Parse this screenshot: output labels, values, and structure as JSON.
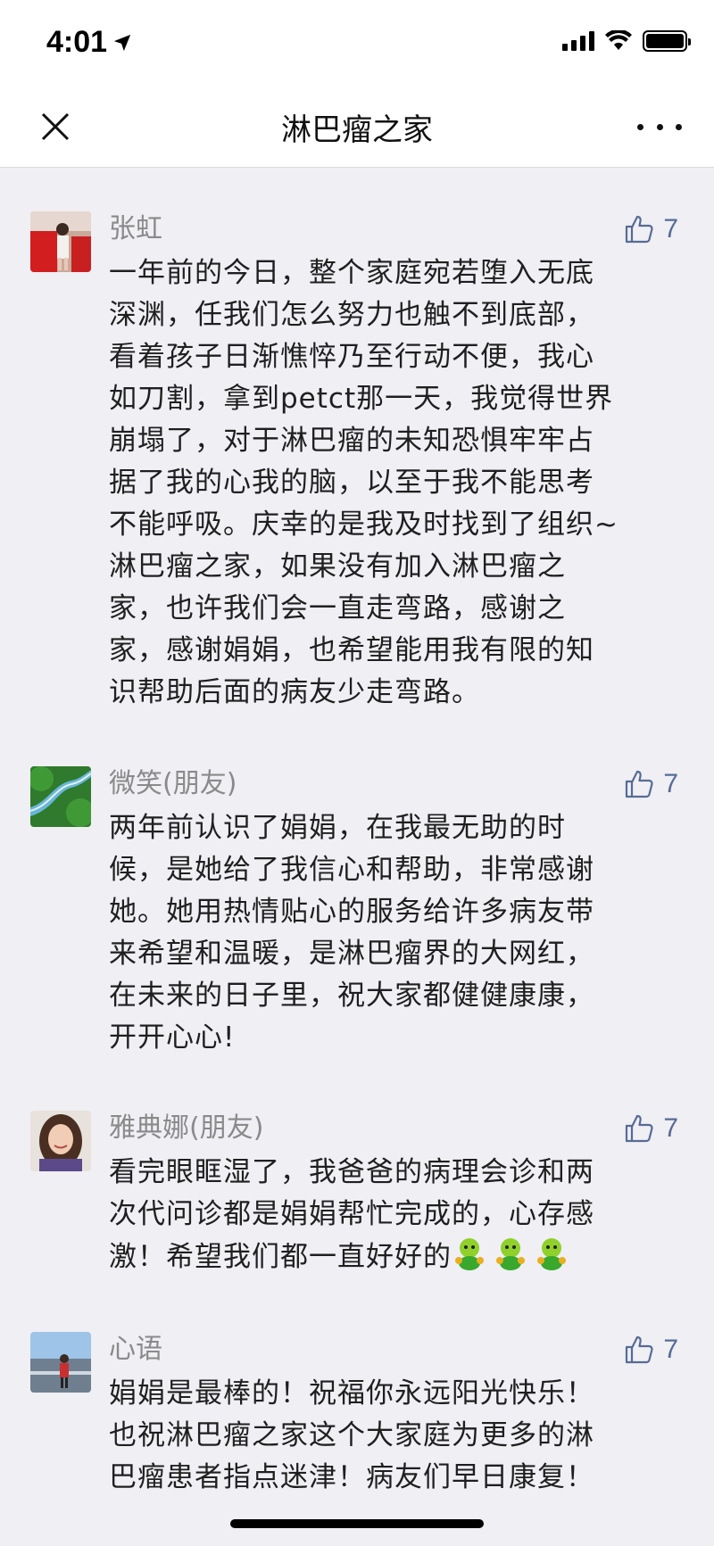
{
  "status_bar": {
    "time": "4:01"
  },
  "header": {
    "title": "淋巴瘤之家"
  },
  "colors": {
    "accent": "#576b95",
    "name_gray": "#8a8a8a",
    "background": "#efeff4"
  },
  "comments": [
    {
      "name": "张虹",
      "likes": "7",
      "text": "一年前的今日，整个家庭宛若堕入无底\n深渊，任我们怎么努力也触不到底部，\n看着孩子日渐憔悴乃至行动不便，我心\n如刀割，拿到petct那一天，我觉得世界\n崩塌了，对于淋巴瘤的未知恐惧牢牢占\n据了我的心我的脑，以至于我不能思考\n不能呼吸。庆幸的是我及时找到了组织~\n淋巴瘤之家，如果没有加入淋巴瘤之\n家，也许我们会一直走弯路，感谢之\n家，感谢娟娟，也希望能用我有限的知\n识帮助后面的病友少走弯路。"
    },
    {
      "name": "微笑(朋友)",
      "likes": "7",
      "text": "两年前认识了娟娟，在我最无助的时\n候，是她给了我信心和帮助，非常感谢\n她。她用热情贴心的服务给许多病友带\n来希望和温暖，是淋巴瘤界的大网红，\n在未来的日子里，祝大家都健健康康，\n开开心心!"
    },
    {
      "name": "雅典娜(朋友)",
      "likes": "7",
      "text": "看完眼眶湿了，我爸爸的病理会诊和两\n次代问诊都是娟娟帮忙完成的，心存感\n激！希望我们都一直好好的"
    },
    {
      "name": "心语",
      "likes": "7",
      "text": "娟娟是最棒的！祝福你永远阳光快乐！\n也祝淋巴瘤之家这个大家庭为更多的淋\n巴瘤患者指点迷津！病友们早日康复！"
    }
  ]
}
